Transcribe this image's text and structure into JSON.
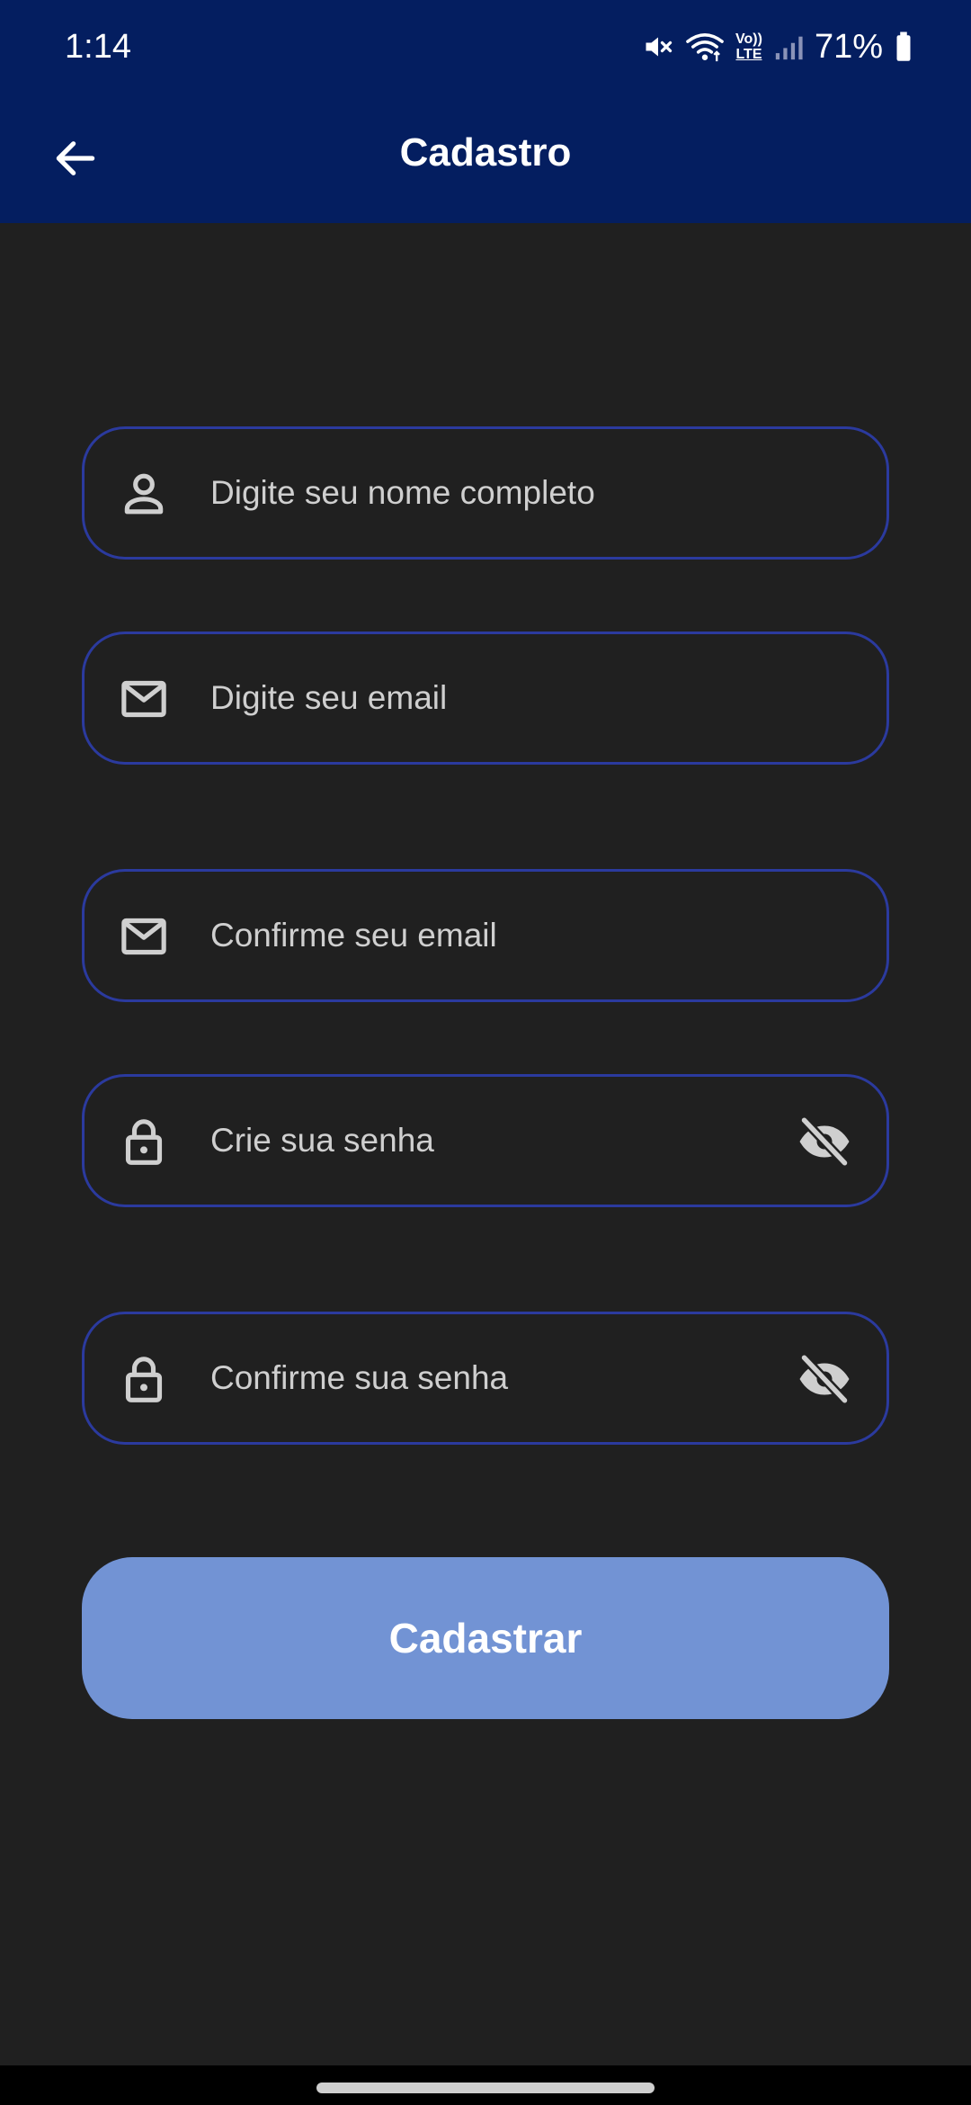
{
  "status_bar": {
    "time": "1:14",
    "battery": "71%",
    "icons": [
      "mute-icon",
      "wifi-icon",
      "volte-icon",
      "signal-icon",
      "battery-icon"
    ],
    "volte_label_top": "Vo))",
    "volte_label_bottom": "LTE"
  },
  "header": {
    "title": "Cadastro",
    "back_icon": "arrow-left-icon"
  },
  "form": {
    "name": {
      "placeholder": "Digite seu nome completo",
      "value": "",
      "icon": "person-icon"
    },
    "email": {
      "placeholder": "Digite seu email",
      "value": "",
      "icon": "mail-icon"
    },
    "email_confirm": {
      "placeholder": "Confirme seu email",
      "value": "",
      "icon": "mail-icon"
    },
    "password": {
      "placeholder": "Crie sua senha",
      "value": "",
      "icon": "lock-icon",
      "visibility_icon": "eye-off-icon"
    },
    "password_confirm": {
      "placeholder": "Confirme sua senha",
      "value": "",
      "icon": "lock-icon",
      "visibility_icon": "eye-off-icon"
    },
    "submit_label": "Cadastrar"
  },
  "colors": {
    "header_bg": "#041e60",
    "page_bg": "#202020",
    "field_border": "#2b3a9e",
    "button_bg": "#7293d4",
    "text_muted": "#cfcfcf"
  }
}
